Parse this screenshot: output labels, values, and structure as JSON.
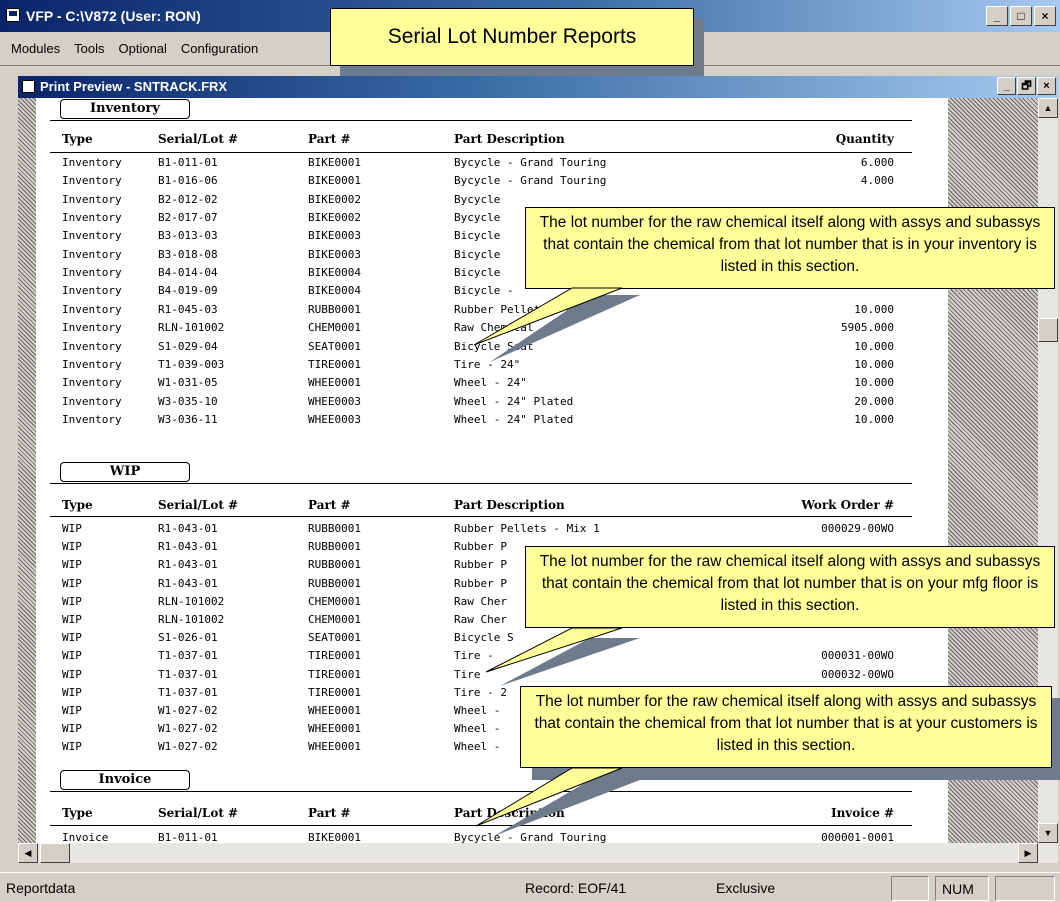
{
  "app": {
    "title": "VFP - C:\\V872 (User: RON)",
    "window_buttons": [
      "_",
      "□",
      "×"
    ]
  },
  "menu": [
    "Modules",
    "Tools",
    "Optional",
    "Configuration"
  ],
  "title_callout": "Serial Lot Number Reports",
  "preview": {
    "title": "Print Preview - SNTRACK.FRX",
    "window_buttons": [
      "_",
      "🗗",
      "×"
    ]
  },
  "sections": {
    "inventory": {
      "label": "Inventory",
      "headers": [
        "Type",
        "Serial/Lot #",
        "Part #",
        "Part Description",
        "Quantity"
      ],
      "rows": [
        [
          "Inventory",
          "B1-011-01",
          "BIKE0001",
          "Bycycle - Grand Touring",
          "6.000"
        ],
        [
          "Inventory",
          "B1-016-06",
          "BIKE0001",
          "Bycycle - Grand Touring",
          "4.000"
        ],
        [
          "Inventory",
          "B2-012-02",
          "BIKE0002",
          "Bycycle",
          ""
        ],
        [
          "Inventory",
          "B2-017-07",
          "BIKE0002",
          "Bycycle",
          ""
        ],
        [
          "Inventory",
          "B3-013-03",
          "BIKE0003",
          "Bicycle",
          ""
        ],
        [
          "Inventory",
          "B3-018-08",
          "BIKE0003",
          "Bicycle",
          ""
        ],
        [
          "Inventory",
          "B4-014-04",
          "BIKE0004",
          "Bicycle",
          ""
        ],
        [
          "Inventory",
          "B4-019-09",
          "BIKE0004",
          "Bicycle -",
          ""
        ],
        [
          "Inventory",
          "R1-045-03",
          "RUBB0001",
          "Rubber Pellets - Mix 1",
          "10.000"
        ],
        [
          "Inventory",
          "RLN-101002",
          "CHEM0001",
          "Raw Chemical",
          "5905.000"
        ],
        [
          "Inventory",
          "S1-029-04",
          "SEAT0001",
          "Bicycle Seat",
          "10.000"
        ],
        [
          "Inventory",
          "T1-039-003",
          "TIRE0001",
          "Tire - 24\"",
          "10.000"
        ],
        [
          "Inventory",
          "W1-031-05",
          "WHEE0001",
          "Wheel - 24\"",
          "10.000"
        ],
        [
          "Inventory",
          "W3-035-10",
          "WHEE0003",
          "Wheel - 24\" Plated",
          "20.000"
        ],
        [
          "Inventory",
          "W3-036-11",
          "WHEE0003",
          "Wheel - 24\" Plated",
          "10.000"
        ]
      ]
    },
    "wip": {
      "label": "WIP",
      "headers": [
        "Type",
        "Serial/Lot #",
        "Part #",
        "Part Description",
        "Work Order #"
      ],
      "rows": [
        [
          "WIP",
          "R1-043-01",
          "RUBB0001",
          "Rubber Pellets - Mix 1",
          "000029-00WO"
        ],
        [
          "WIP",
          "R1-043-01",
          "RUBB0001",
          "Rubber P",
          ""
        ],
        [
          "WIP",
          "R1-043-01",
          "RUBB0001",
          "Rubber P",
          ""
        ],
        [
          "WIP",
          "R1-043-01",
          "RUBB0001",
          "Rubber P",
          ""
        ],
        [
          "WIP",
          "RLN-101002",
          "CHEM0001",
          "Raw Cher",
          ""
        ],
        [
          "WIP",
          "RLN-101002",
          "CHEM0001",
          "Raw Cher",
          ""
        ],
        [
          "WIP",
          "S1-026-01",
          "SEAT0001",
          "Bicycle S",
          ""
        ],
        [
          "WIP",
          "T1-037-01",
          "TIRE0001",
          "Tire -",
          "000031-00WO"
        ],
        [
          "WIP",
          "T1-037-01",
          "TIRE0001",
          "Tire",
          "000032-00WO"
        ],
        [
          "WIP",
          "T1-037-01",
          "TIRE0001",
          "Tire - 2",
          ""
        ],
        [
          "WIP",
          "W1-027-02",
          "WHEE0001",
          "Wheel -",
          ""
        ],
        [
          "WIP",
          "W1-027-02",
          "WHEE0001",
          "Wheel -",
          ""
        ],
        [
          "WIP",
          "W1-027-02",
          "WHEE0001",
          "Wheel -",
          ""
        ]
      ]
    },
    "invoice": {
      "label": "Invoice",
      "headers": [
        "Type",
        "Serial/Lot #",
        "Part #",
        "Part Description",
        "Invoice #"
      ],
      "rows": [
        [
          "Invoice",
          "B1-011-01",
          "BIKE0001",
          "Bycycle - Grand Touring",
          "000001-0001"
        ]
      ]
    }
  },
  "callouts": {
    "inventory": "The lot number for the raw chemical itself along with assys and subassys that contain  the chemical from that lot number that is in your inventory is listed in this section.",
    "wip": "The lot number for the raw chemical itself along with assys and subassys that contain  the chemical from that lot number that is on your mfg floor is listed in this section.",
    "invoice": "The lot number for the raw chemical itself along with assys and subassys that contain  the chemical from that lot number that is at your customers is listed in this section."
  },
  "status": {
    "left": "Reportdata",
    "record": "Record: EOF/41",
    "mode": "Exclusive",
    "num": "NUM"
  },
  "scroll_icons": [
    "scroll-up-icon",
    "scroll-down-icon",
    "scroll-left-icon",
    "scroll-right-icon"
  ]
}
